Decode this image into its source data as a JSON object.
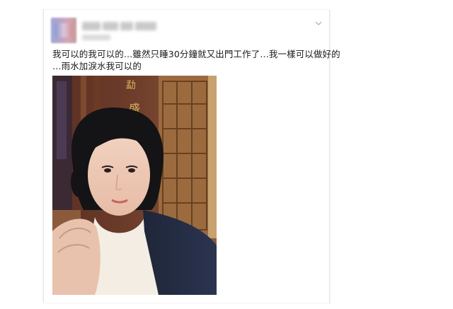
{
  "post": {
    "text_line_1": "我可以的我可以的…雖然只睡30分鐘就又出門工作了…我一樣可以做好的",
    "text_line_2": "…雨水加淚水我可以的"
  },
  "header": {
    "menu_icon": "chevron-down-icon"
  },
  "colors": {
    "text": "#1a1a1a",
    "border": "#e6e6e6"
  }
}
